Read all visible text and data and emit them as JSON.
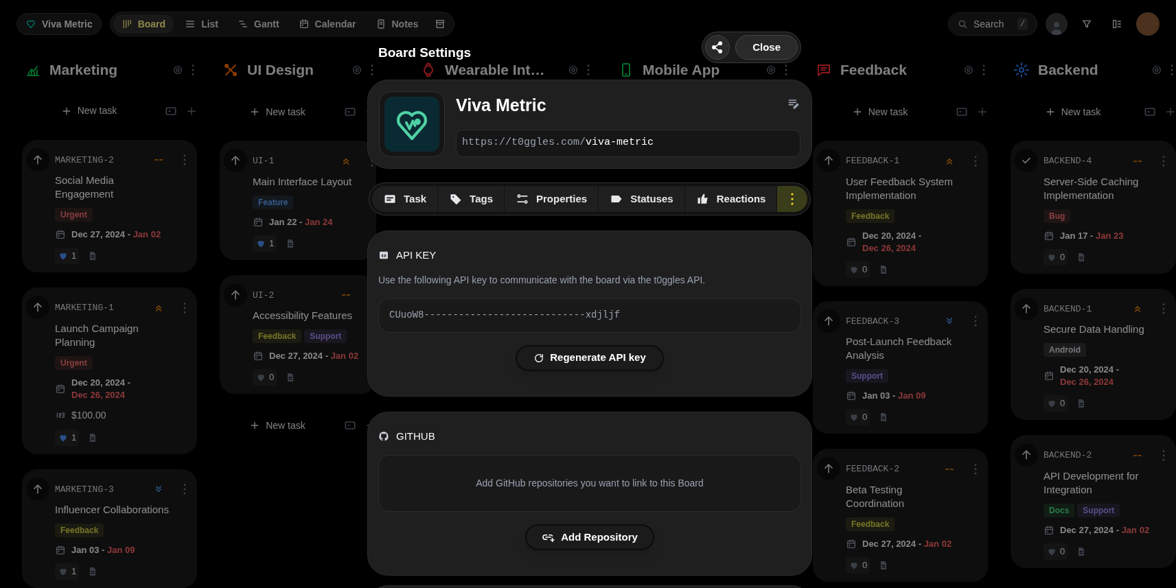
{
  "topbar": {
    "board_name": "Viva Metric",
    "views": [
      {
        "label": "Board",
        "selected": true
      },
      {
        "label": "List",
        "selected": false
      },
      {
        "label": "Gantt",
        "selected": false
      },
      {
        "label": "Calendar",
        "selected": false
      },
      {
        "label": "Notes",
        "selected": false
      }
    ],
    "search": {
      "placeholder": "Search",
      "shortcut": "/"
    }
  },
  "columns": [
    {
      "name": "Marketing",
      "new_task": "New task",
      "cards": [
        {
          "id": "MARKETING-2",
          "done": false,
          "priority_icon": {
            "kind": "none"
          },
          "title": "Social Media Engagement",
          "tags": [
            {
              "label": "Urgent",
              "kind": "urgent"
            }
          ],
          "start": "Dec 27, 2024 -",
          "end": "Jan 02",
          "reactions": "1",
          "liked": true
        },
        {
          "id": "MARKETING-1",
          "done": false,
          "priority_icon": {
            "kind": "high"
          },
          "title": "Launch Campaign Planning",
          "tags": [
            {
              "label": "Urgent",
              "kind": "urgent"
            }
          ],
          "start": "Dec 20, 2024 -",
          "end": "Dec 26, 2024",
          "amount": "$100.00",
          "reactions": "1",
          "liked": true
        },
        {
          "id": "MARKETING-3",
          "done": false,
          "priority_icon": {
            "kind": "low"
          },
          "title": "Influencer Collaborations",
          "tags": [
            {
              "label": "Feedback",
              "kind": "feedback"
            }
          ],
          "start": "Jan 03 -",
          "end": "Jan 09",
          "reactions": "1",
          "liked": false
        }
      ]
    },
    {
      "name": "UI Design",
      "new_task": "New task",
      "cards": [
        {
          "id": "UI-1",
          "done": false,
          "priority_icon": {
            "kind": "high"
          },
          "title": "Main Interface Layout",
          "tags": [
            {
              "label": "Feature",
              "kind": "feature"
            }
          ],
          "start": "Jan 22 -",
          "end": "Jan 24",
          "reactions": "1",
          "liked": true
        },
        {
          "id": "UI-2",
          "done": false,
          "priority_icon": {
            "kind": "none"
          },
          "title": "Accessibility Features",
          "tags": [
            {
              "label": "Feedback",
              "kind": "feedback"
            },
            {
              "label": "Support",
              "kind": "support"
            }
          ],
          "start": "Dec 27, 2024 -",
          "end": "Jan 02",
          "reactions": "0",
          "liked": false
        }
      ],
      "footer_new_task": "New task"
    },
    {
      "name": "Wearable Int…"
    },
    {
      "name": "Mobile App"
    },
    {
      "name": "Feedback",
      "new_task": "New task",
      "cards": [
        {
          "id": "FEEDBACK-1",
          "done": false,
          "priority_icon": {
            "kind": "high"
          },
          "title": "User Feedback System Implementation",
          "tags": [
            {
              "label": "Feedback",
              "kind": "feedback"
            }
          ],
          "start": "Dec 20, 2024 -",
          "end": "Dec 26, 2024",
          "reactions": "0",
          "liked": false
        },
        {
          "id": "FEEDBACK-3",
          "done": false,
          "priority_icon": {
            "kind": "low"
          },
          "title": "Post-Launch Feedback Analysis",
          "tags": [
            {
              "label": "Support",
              "kind": "support"
            }
          ],
          "start": "Jan 03 -",
          "end": "Jan 09",
          "reactions": "0",
          "liked": false
        },
        {
          "id": "FEEDBACK-2",
          "done": false,
          "priority_icon": {
            "kind": "none"
          },
          "title": "Beta Testing Coordination",
          "tags": [
            {
              "label": "Feedback",
              "kind": "feedback"
            }
          ],
          "start": "Dec 27, 2024 -",
          "end": "Jan 02",
          "reactions": "0",
          "liked": false
        }
      ]
    },
    {
      "name": "Backend",
      "new_task": "New task",
      "cards": [
        {
          "id": "BACKEND-4",
          "done": true,
          "priority_icon": {
            "kind": "none"
          },
          "title": "Server-Side Caching Implementation",
          "tags": [
            {
              "label": "Bug",
              "kind": "bug"
            }
          ],
          "start": "Jan 17 -",
          "end": "Jan 23",
          "reactions": "0",
          "liked": false
        },
        {
          "id": "BACKEND-1",
          "done": false,
          "priority_icon": {
            "kind": "high"
          },
          "title": "Secure Data Handling",
          "tags": [
            {
              "label": "Android",
              "kind": "android"
            }
          ],
          "start": "Dec 20, 2024 -",
          "end": "Dec 26, 2024",
          "reactions": "0",
          "liked": false
        },
        {
          "id": "BACKEND-2",
          "done": false,
          "priority_icon": {
            "kind": "none"
          },
          "title": "API Development for Integration",
          "tags": [
            {
              "label": "Docs",
              "kind": "docs"
            },
            {
              "label": "Support",
              "kind": "support"
            }
          ],
          "start": "Dec 27, 2024 -",
          "end": "Jan 02",
          "reactions": "0",
          "liked": false
        }
      ]
    }
  ],
  "modal": {
    "title": "Board Settings",
    "close": "Close",
    "board": {
      "name": "Viva Metric",
      "url_prefix": "https://t0ggles.com/",
      "url_slug": "viva-metric"
    },
    "tabs": [
      {
        "label": "Task",
        "selected": false
      },
      {
        "label": "Tags",
        "selected": false
      },
      {
        "label": "Properties",
        "selected": false
      },
      {
        "label": "Statuses",
        "selected": false
      },
      {
        "label": "Reactions",
        "selected": false
      }
    ],
    "more_selected": true,
    "api_key": {
      "heading": "API KEY",
      "description": "Use the following API key to communicate with the board via the t0ggles API.",
      "value": "CUuoW8----------------------------xdjljf",
      "button": "Regenerate API key"
    },
    "github": {
      "heading": "GITHUB",
      "empty_text": "Add GitHub repositories you want to link to this Board",
      "button": "Add Repository"
    }
  }
}
